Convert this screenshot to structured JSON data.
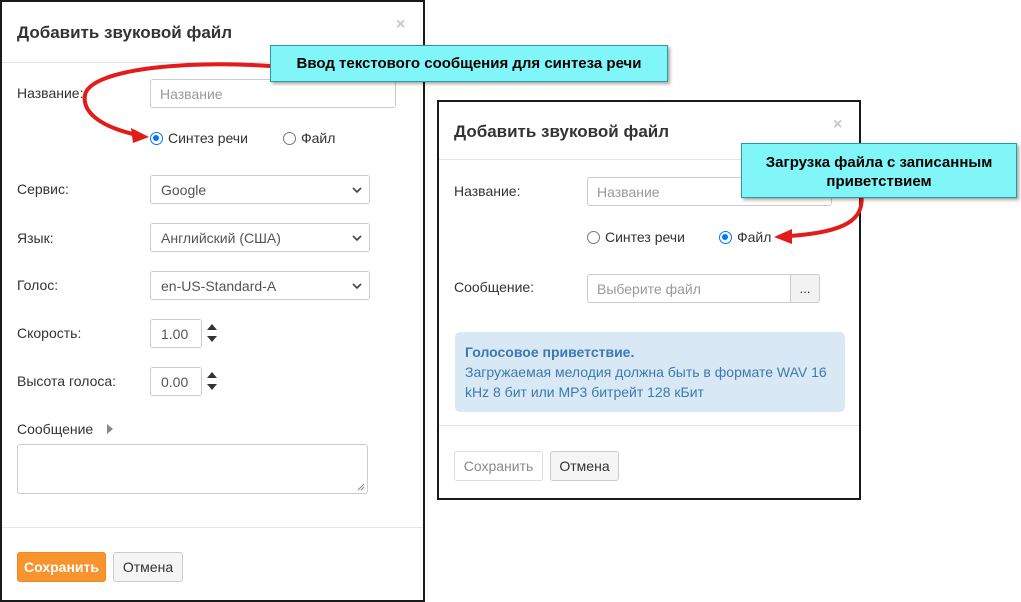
{
  "dialog_tts": {
    "title": "Добавить звуковой файл",
    "close_glyph": "×",
    "name_label": "Название:",
    "name_placeholder": "Название",
    "radio_tts_label": "Синтез речи",
    "radio_file_label": "Файл",
    "selected_mode": "Синтез речи",
    "service_label": "Сервис:",
    "service_value": "Google",
    "language_label": "Язык:",
    "language_value": "Английский (США)",
    "voice_label": "Голос:",
    "voice_value": "en-US-Standard-A",
    "speed_label": "Скорость:",
    "speed_value": "1.00",
    "pitch_label": "Высота голоса:",
    "pitch_value": "0.00",
    "message_label": "Сообщение",
    "save_label": "Сохранить",
    "cancel_label": "Отмена"
  },
  "dialog_file": {
    "title": "Добавить звуковой файл",
    "close_glyph": "×",
    "name_label": "Название:",
    "name_placeholder": "Название",
    "radio_tts_label": "Синтез речи",
    "radio_file_label": "Файл",
    "selected_mode": "Файл",
    "message_label": "Сообщение:",
    "file_placeholder": "Выберите файл",
    "browse_label": "...",
    "info_title": "Голосовое приветствие.",
    "info_text": "Загружаемая мелодия должна быть в формате WAV 16 kHz 8 бит или MP3 битрейт 128 кБит",
    "save_label": "Сохранить",
    "cancel_label": "Отмена"
  },
  "callouts": {
    "tts": "Ввод текстового сообщения для синтеза речи",
    "file": "Загрузка файла с записанным приветствием"
  },
  "colors": {
    "primary_button": "#f7942d",
    "radio_selected": "#0075ff",
    "callout_bg": "#80f6f8",
    "arrow": "#e31b1b",
    "info_bg": "#d9e8f5",
    "info_text": "#3a7ab0"
  },
  "icons": [
    "close-icon",
    "chevron-down-icon",
    "spinner-icon",
    "expand-triangle-icon",
    "resize-grip-icon",
    "arrow-icon"
  ]
}
